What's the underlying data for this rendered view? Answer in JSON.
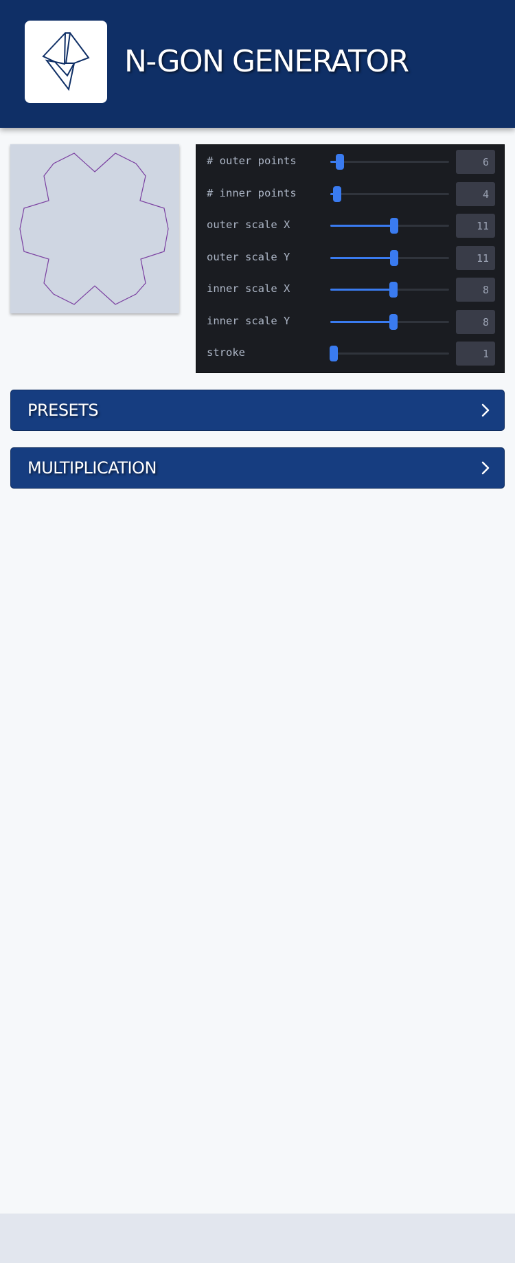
{
  "header": {
    "title": "N-GON GENERATOR",
    "logo_icon": "star-logo-icon"
  },
  "preview": {
    "shape_icon": "ngon-shape",
    "stroke_color": "#7a3fa0",
    "background": "#cfd6e2"
  },
  "controls": [
    {
      "label": "# outer points",
      "value": "6",
      "level": 0.08
    },
    {
      "label": "# inner points",
      "value": "4",
      "level": 0.06
    },
    {
      "label": "outer scale X",
      "value": "11",
      "level": 0.54
    },
    {
      "label": "outer scale Y",
      "value": "11",
      "level": 0.54
    },
    {
      "label": "inner scale X",
      "value": "8",
      "level": 0.53
    },
    {
      "label": "inner scale Y",
      "value": "8",
      "level": 0.53
    },
    {
      "label": "stroke",
      "value": "1",
      "level": 0.03
    }
  ],
  "sections": {
    "presets": {
      "label": "PRESETS",
      "icon": "chevron-right-icon"
    },
    "multiplication": {
      "label": "MULTIPLICATION",
      "icon": "chevron-right-icon"
    }
  },
  "colors": {
    "header": "#0f2f66",
    "accent": "#3a7bf0",
    "panel": "#1a1c21",
    "section": "#163d80"
  }
}
